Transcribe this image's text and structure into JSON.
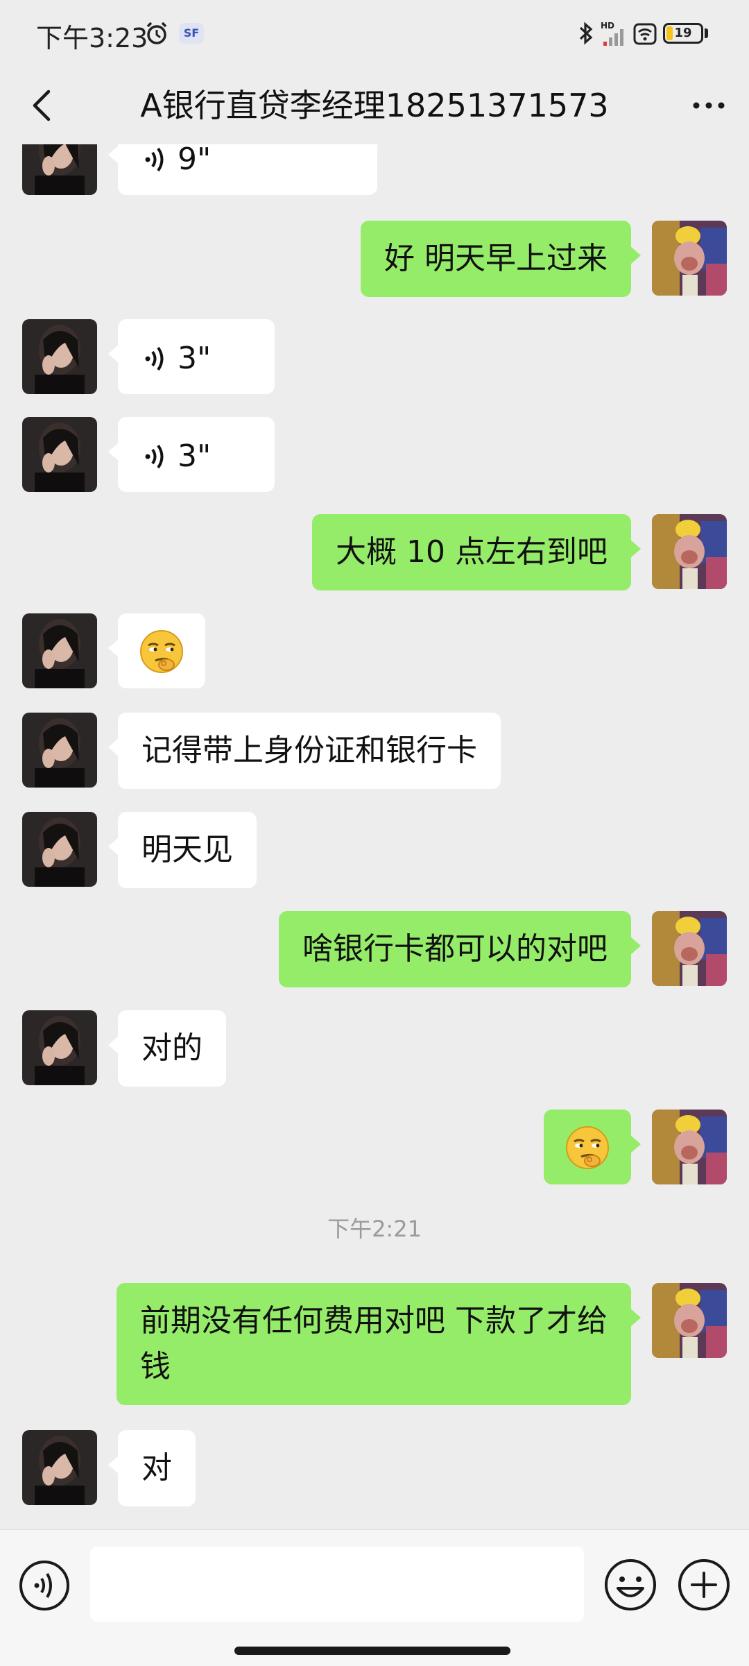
{
  "status_bar": {
    "time": "下午3:23",
    "sf_badge": "SF",
    "hd_label": "HD",
    "battery_level": "19",
    "battery_fraction": 0.19,
    "battery_accent": "#f6c31c"
  },
  "header": {
    "title": "A银行直贷李经理18251371573",
    "back_icon": "chevron-left-icon",
    "more_icon": "more-dots-icon"
  },
  "colors": {
    "sent_bubble": "#95ec69",
    "received_bubble": "#ffffff",
    "background": "#ededed"
  },
  "messages": [
    {
      "side": "left",
      "type": "voice",
      "duration": "9\""
    },
    {
      "side": "right",
      "type": "text",
      "text": "好  明天早上过来"
    },
    {
      "side": "left",
      "type": "voice",
      "duration": "3\""
    },
    {
      "side": "left",
      "type": "voice",
      "duration": "3\""
    },
    {
      "side": "right",
      "type": "text",
      "text": "大概 10 点左右到吧"
    },
    {
      "side": "left",
      "type": "emoji",
      "emoji": "smirk-emoji"
    },
    {
      "side": "left",
      "type": "text",
      "text": "记得带上身份证和银行卡"
    },
    {
      "side": "left",
      "type": "text",
      "text": "明天见"
    },
    {
      "side": "right",
      "type": "text",
      "text": "啥银行卡都可以的对吧"
    },
    {
      "side": "left",
      "type": "text",
      "text": "对的"
    },
    {
      "side": "right",
      "type": "emoji",
      "emoji": "smirk-emoji"
    },
    {
      "side": "right",
      "type": "text",
      "text": "前期没有任何费用对吧  下款了才给钱"
    },
    {
      "side": "left",
      "type": "text",
      "text": "对"
    }
  ],
  "time_divider": "下午2:21",
  "input_bar": {
    "placeholder": "",
    "voice_icon": "voice-toggle-icon",
    "emoji_icon": "emoji-icon",
    "plus_icon": "plus-icon"
  }
}
